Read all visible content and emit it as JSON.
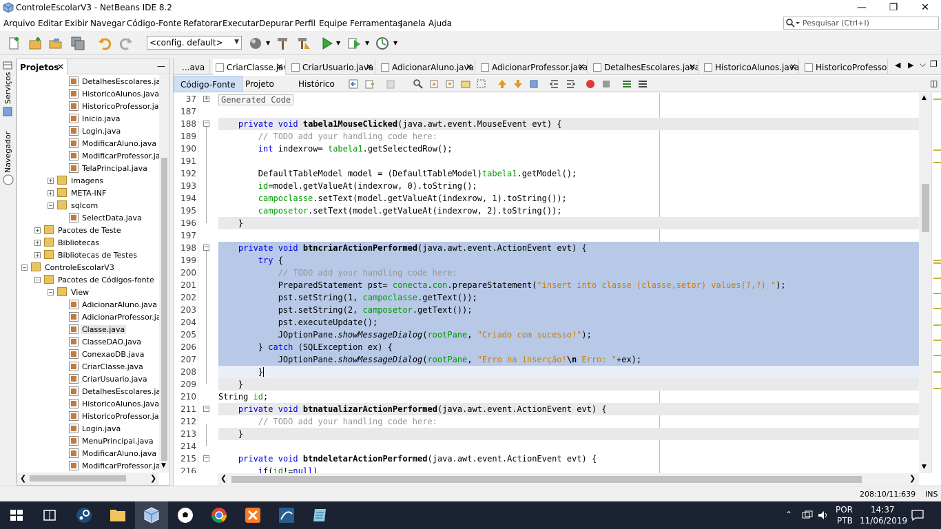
{
  "window": {
    "title": "ControleEscolarV3 - NetBeans IDE 8.2"
  },
  "menu": [
    "Arquivo",
    "Editar",
    "Exibir",
    "Navegar",
    "Código-Fonte",
    "Refatorar",
    "Executar",
    "Depurar",
    "Perfil",
    "Equipe",
    "Ferramentas",
    "Janela",
    "Ajuda"
  ],
  "search": {
    "placeholder": "Pesquisar (Ctrl+I)"
  },
  "toolbar": {
    "config_value": "<config. default>"
  },
  "side_strip": {
    "services": "Serviços",
    "navigator": "Navegador"
  },
  "projects": {
    "tab_label": "Projetos",
    "tree": [
      {
        "label": "DetalhesEscolares.jav",
        "kind": "file",
        "depth": 4
      },
      {
        "label": "HistoricoAlunos.java",
        "kind": "file",
        "depth": 4
      },
      {
        "label": "HistoricoProfessor.jav",
        "kind": "file",
        "depth": 4
      },
      {
        "label": "Inicio.java",
        "kind": "file",
        "depth": 4
      },
      {
        "label": "Login.java",
        "kind": "file",
        "depth": 4
      },
      {
        "label": "ModificarAluno.java",
        "kind": "file",
        "depth": 4
      },
      {
        "label": "ModificarProfessor.jav",
        "kind": "file",
        "depth": 4
      },
      {
        "label": "TelaPrincipal.java",
        "kind": "file",
        "depth": 4
      },
      {
        "label": "Imagens",
        "kind": "package",
        "depth": 3,
        "toggle": "+"
      },
      {
        "label": "META-INF",
        "kind": "package",
        "depth": 3,
        "toggle": "+"
      },
      {
        "label": "sqlcom",
        "kind": "package",
        "depth": 3,
        "toggle": "-"
      },
      {
        "label": "SelectData.java",
        "kind": "file",
        "depth": 4
      },
      {
        "label": "Pacotes de Teste",
        "kind": "package",
        "depth": 2,
        "toggle": "+"
      },
      {
        "label": "Bibliotecas",
        "kind": "package",
        "depth": 2,
        "toggle": "+"
      },
      {
        "label": "Bibliotecas de Testes",
        "kind": "package",
        "depth": 2,
        "toggle": "+"
      },
      {
        "label": "ControleEscolarV3",
        "kind": "project",
        "depth": 1,
        "toggle": "-"
      },
      {
        "label": "Pacotes de Códigos-fonte",
        "kind": "package",
        "depth": 2,
        "toggle": "-"
      },
      {
        "label": "View",
        "kind": "package",
        "depth": 3,
        "toggle": "-"
      },
      {
        "label": "AdicionarAluno.java",
        "kind": "file",
        "depth": 4
      },
      {
        "label": "AdicionarProfessor.ja",
        "kind": "file",
        "depth": 4
      },
      {
        "label": "Classe.java",
        "kind": "file",
        "depth": 4,
        "selected": true
      },
      {
        "label": "ClasseDAO.java",
        "kind": "file",
        "depth": 4
      },
      {
        "label": "ConexaoDB.java",
        "kind": "file",
        "depth": 4
      },
      {
        "label": "CriarClasse.java",
        "kind": "file",
        "depth": 4
      },
      {
        "label": "CriarUsuario.java",
        "kind": "file",
        "depth": 4
      },
      {
        "label": "DetalhesEscolares.jav",
        "kind": "file",
        "depth": 4
      },
      {
        "label": "HistoricoAlunos.java",
        "kind": "file",
        "depth": 4
      },
      {
        "label": "HistoricoProfessor.jav",
        "kind": "file",
        "depth": 4
      },
      {
        "label": "Login.java",
        "kind": "file",
        "depth": 4
      },
      {
        "label": "MenuPrincipal.java",
        "kind": "file",
        "depth": 4
      },
      {
        "label": "ModificarAluno.java",
        "kind": "file",
        "depth": 4
      },
      {
        "label": "ModificarProfessor.jav",
        "kind": "file",
        "depth": 4
      }
    ]
  },
  "editor": {
    "tabs": [
      {
        "label": "...ava",
        "closable": false
      },
      {
        "label": "CriarClasse.java",
        "closable": true,
        "active": true
      },
      {
        "label": "CriarUsuario.java",
        "closable": true
      },
      {
        "label": "AdicionarAluno.java",
        "closable": true
      },
      {
        "label": "AdicionarProfessor.java",
        "closable": true
      },
      {
        "label": "DetalhesEscolares.java",
        "closable": true
      },
      {
        "label": "HistoricoAlunos.java",
        "closable": true
      },
      {
        "label": "HistoricoProfessor....",
        "closable": false
      }
    ],
    "subtabs": [
      "Código-Fonte",
      "Projeto",
      "Histórico"
    ],
    "lines": [
      {
        "n": "37",
        "fold": "+",
        "bg": "none",
        "parts": [
          [
            "gen",
            "Generated Code"
          ]
        ]
      },
      {
        "n": "187",
        "bg": "none",
        "parts": []
      },
      {
        "n": "188",
        "fold": "-",
        "bg": "hl",
        "parts": [
          [
            "",
            "    "
          ],
          [
            "kw",
            "private"
          ],
          [
            "",
            " "
          ],
          [
            "kw",
            "void"
          ],
          [
            "",
            " "
          ],
          [
            "mt",
            "tabela1MouseClicked"
          ],
          [
            "",
            "(java.awt.event.MouseEvent evt) {"
          ]
        ]
      },
      {
        "n": "189",
        "bg": "none",
        "parts": [
          [
            "",
            "        "
          ],
          [
            "cm",
            "// TODO add your handling code here:"
          ]
        ]
      },
      {
        "n": "190",
        "bg": "none",
        "parts": [
          [
            "",
            "        "
          ],
          [
            "kw",
            "int"
          ],
          [
            "",
            " indexrow= "
          ],
          [
            "fd",
            "tabela1"
          ],
          [
            "",
            ".getSelectedRow();"
          ]
        ]
      },
      {
        "n": "191",
        "bg": "none",
        "parts": []
      },
      {
        "n": "192",
        "bg": "none",
        "parts": [
          [
            "",
            "        DefaultTableModel model = (DefaultTableModel)"
          ],
          [
            "fd",
            "tabela1"
          ],
          [
            "",
            ".getModel();"
          ]
        ]
      },
      {
        "n": "193",
        "bg": "none",
        "parts": [
          [
            "",
            "        "
          ],
          [
            "fd",
            "id"
          ],
          [
            "",
            "=model.getValueAt(indexrow, 0).toString();"
          ]
        ]
      },
      {
        "n": "194",
        "bg": "none",
        "parts": [
          [
            "",
            "        "
          ],
          [
            "fd",
            "campoclasse"
          ],
          [
            "",
            ".setText(model.getValueAt(indexrow, 1).toString());"
          ]
        ]
      },
      {
        "n": "195",
        "bg": "none",
        "parts": [
          [
            "",
            "        "
          ],
          [
            "fd",
            "camposetor"
          ],
          [
            "",
            ".setText(model.getValueAt(indexrow, 2).toString());"
          ]
        ]
      },
      {
        "n": "196",
        "bg": "hl",
        "parts": [
          [
            "",
            "    }"
          ]
        ]
      },
      {
        "n": "197",
        "bg": "none",
        "parts": []
      },
      {
        "n": "198",
        "fold": "-",
        "bg": "sel",
        "parts": [
          [
            "",
            "    "
          ],
          [
            "kw",
            "private"
          ],
          [
            "",
            " "
          ],
          [
            "kw",
            "void"
          ],
          [
            "",
            " "
          ],
          [
            "mt",
            "btncriarActionPerformed"
          ],
          [
            "",
            "(java.awt.event.ActionEvent evt) {"
          ]
        ]
      },
      {
        "n": "199",
        "bg": "sel",
        "parts": [
          [
            "",
            "        "
          ],
          [
            "kw",
            "try"
          ],
          [
            "",
            " {"
          ]
        ]
      },
      {
        "n": "200",
        "bg": "sel",
        "parts": [
          [
            "",
            "            "
          ],
          [
            "cm",
            "// TODO add your handling code here:"
          ]
        ]
      },
      {
        "n": "201",
        "bg": "sel",
        "parts": [
          [
            "",
            "            PreparedStatement pst= "
          ],
          [
            "fd",
            "conecta"
          ],
          [
            "",
            "."
          ],
          [
            "fd",
            "con"
          ],
          [
            "",
            ".prepareStatement("
          ],
          [
            "st",
            "\"insert into classe (classe,setor) values(?,?) \""
          ],
          [
            "",
            ");"
          ]
        ]
      },
      {
        "n": "202",
        "bg": "sel",
        "parts": [
          [
            "",
            "            pst.setString(1, "
          ],
          [
            "fd",
            "campoclasse"
          ],
          [
            "",
            ".getText());"
          ]
        ]
      },
      {
        "n": "203",
        "bg": "sel",
        "parts": [
          [
            "",
            "            pst.setString(2, "
          ],
          [
            "fd",
            "camposetor"
          ],
          [
            "",
            ".getText());"
          ]
        ]
      },
      {
        "n": "204",
        "bg": "sel",
        "parts": [
          [
            "",
            "            pst.executeUpdate();"
          ]
        ]
      },
      {
        "n": "205",
        "bg": "sel",
        "parts": [
          [
            "",
            "            JOptionPane."
          ],
          [
            "it",
            "showMessageDialog"
          ],
          [
            "",
            "("
          ],
          [
            "fd",
            "rootPane"
          ],
          [
            "",
            ", "
          ],
          [
            "st",
            "\"Criado com sucesso!\""
          ],
          [
            "",
            ");"
          ]
        ]
      },
      {
        "n": "206",
        "bg": "sel",
        "parts": [
          [
            "",
            "        } "
          ],
          [
            "kw",
            "catch"
          ],
          [
            "",
            " (SQLException ex) {"
          ]
        ]
      },
      {
        "n": "207",
        "bg": "sel",
        "parts": [
          [
            "",
            "            JOptionPane."
          ],
          [
            "it",
            "showMessageDialog"
          ],
          [
            "",
            "("
          ],
          [
            "fd",
            "rootPane"
          ],
          [
            "",
            ", "
          ],
          [
            "st",
            "\"Erro na inserção!"
          ],
          [
            "mt",
            "\\n"
          ],
          [
            "st",
            " Erro: \""
          ],
          [
            "",
            "+ex);"
          ]
        ]
      },
      {
        "n": "208",
        "bg": "cur",
        "parts": [
          [
            "",
            "        }"
          ]
        ]
      },
      {
        "n": "209",
        "bg": "hl",
        "parts": [
          [
            "",
            "    }"
          ]
        ]
      },
      {
        "n": "210",
        "bg": "none",
        "parts": [
          [
            "",
            "String "
          ],
          [
            "fd",
            "id"
          ],
          [
            "",
            ";"
          ]
        ]
      },
      {
        "n": "211",
        "fold": "-",
        "bg": "hl",
        "parts": [
          [
            "",
            "    "
          ],
          [
            "kw",
            "private"
          ],
          [
            "",
            " "
          ],
          [
            "kw",
            "void"
          ],
          [
            "",
            " "
          ],
          [
            "mt",
            "btnatualizarActionPerformed"
          ],
          [
            "",
            "(java.awt.event.ActionEvent evt) {"
          ]
        ]
      },
      {
        "n": "212",
        "bg": "none",
        "parts": [
          [
            "",
            "        "
          ],
          [
            "cm",
            "// TODO add your handling code here:"
          ]
        ]
      },
      {
        "n": "213",
        "bg": "hl",
        "parts": [
          [
            "",
            "    }"
          ]
        ]
      },
      {
        "n": "214",
        "bg": "none",
        "parts": []
      },
      {
        "n": "215",
        "fold": "-",
        "bg": "none",
        "parts": [
          [
            "",
            "    "
          ],
          [
            "kw",
            "private"
          ],
          [
            "",
            " "
          ],
          [
            "kw",
            "void"
          ],
          [
            "",
            " "
          ],
          [
            "mt",
            "btndeletarActionPerformed"
          ],
          [
            "",
            "(java.awt.event.ActionEvent evt) {"
          ]
        ]
      },
      {
        "n": "216",
        "bg": "none",
        "parts": [
          [
            "",
            "        "
          ],
          [
            "kw",
            "if"
          ],
          [
            "",
            "("
          ],
          [
            "fd",
            "id"
          ],
          [
            "",
            "!="
          ],
          [
            "kw",
            "null"
          ],
          [
            "",
            ")"
          ]
        ]
      }
    ]
  },
  "status": {
    "position": "208:10/11:639",
    "mode": "INS"
  },
  "taskbar": {
    "lang_top": "POR",
    "lang_bottom": "PTB",
    "time": "14:37",
    "date": "11/06/2019"
  },
  "colors": {
    "selection": "#b7c9e6",
    "keyword": "#0000e6",
    "string": "#ce7b00",
    "field": "#009900",
    "comment": "#969696",
    "taskbar": "#1b2231"
  }
}
